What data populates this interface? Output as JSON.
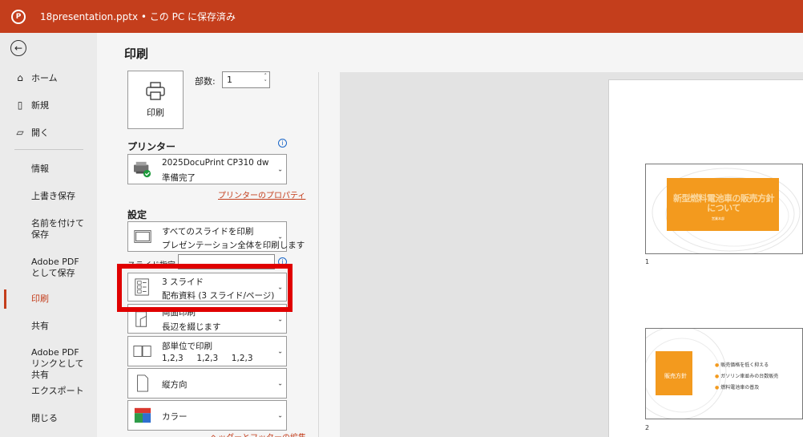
{
  "titlebar": {
    "app_icon": "powerpoint-icon",
    "title": "18presentation.pptx • この PC に保存済み",
    "color": "#c43e1c"
  },
  "nav": {
    "back_icon": "back-arrow-icon",
    "items": [
      {
        "label": "ホーム",
        "icon": "home-icon"
      },
      {
        "label": "新規",
        "icon": "new-file-icon"
      },
      {
        "label": "開く",
        "icon": "open-folder-icon"
      },
      {
        "label": "情報"
      },
      {
        "label": "上書き保存"
      },
      {
        "label": "名前を付けて保存"
      },
      {
        "label": "Adobe PDF として保存"
      },
      {
        "label": "印刷"
      },
      {
        "label": "共有"
      },
      {
        "label": "Adobe PDF リンクとして共有"
      },
      {
        "label": "エクスポート"
      },
      {
        "label": "閉じる"
      }
    ],
    "active": "印刷"
  },
  "print": {
    "title": "印刷",
    "button_label": "印刷",
    "copies_label": "部数:",
    "copies_value": "1",
    "printer_section": "プリンター",
    "printer": {
      "name": "2025DocuPrint CP310 dw",
      "status": "準備完了"
    },
    "printer_properties_link": "プリンターのプロパティ",
    "settings_section": "設定",
    "slides_range": {
      "line1": "すべてのスライドを印刷",
      "line2": "プレゼンテーション全体を印刷します"
    },
    "slide_spec_label": "スライド指定:",
    "slide_spec_value": "",
    "layout": {
      "line1": "3 スライド",
      "line2": "配布資料 (3 スライド/ページ)"
    },
    "duplex": {
      "line1": "両面印刷",
      "line2": "長辺を綴じます"
    },
    "collate": {
      "line1": "部単位で印刷",
      "line2": "1,2,3     1,2,3     1,2,3"
    },
    "orientation": {
      "line1": "縦方向"
    },
    "color": {
      "line1": "カラー"
    },
    "clipped_link": "ヘッダーとフッターの編集"
  },
  "preview": {
    "slides": [
      {
        "number": "1",
        "title": "新型燃料電池車の販売方針について",
        "subtitle": "営業本部"
      },
      {
        "number": "2",
        "label": "販売方針",
        "bullets": [
          "販売価格を低く抑える",
          "ガソリン車並みの台数販売",
          "燃料電池車の普及"
        ]
      }
    ],
    "accent": "#f39a1e"
  }
}
